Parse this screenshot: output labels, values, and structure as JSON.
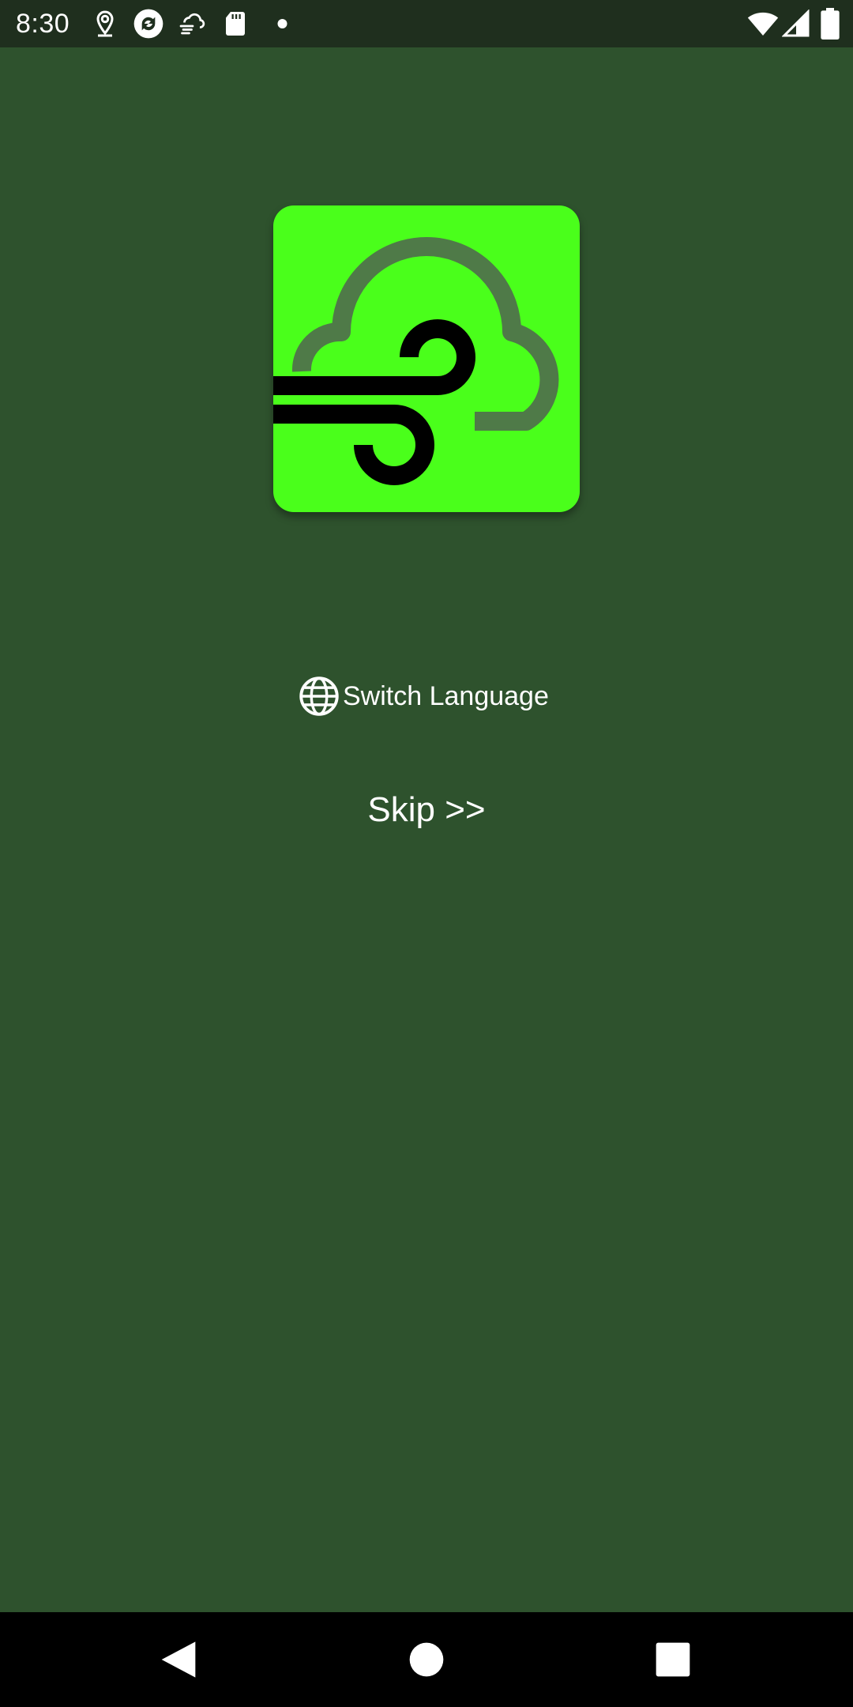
{
  "status_bar": {
    "time": "8:30",
    "icons_left": [
      "location-icon",
      "sync-app-icon",
      "weather-wind-icon",
      "sd-card-icon",
      "notification-dot-icon"
    ],
    "icons_right": [
      "wifi-icon",
      "cell-signal-icon",
      "battery-icon"
    ]
  },
  "colors": {
    "background": "#2e522d",
    "status_bar": "#1f2f1e",
    "logo_background": "#4aff1b",
    "logo_cloud": "#4f7a48",
    "logo_wind": "#000000",
    "text": "#ffffff",
    "nav_bar": "#000000"
  },
  "main": {
    "logo_icon": "cloud-wind-logo-icon",
    "switch_language": {
      "icon": "globe-icon",
      "label": "Switch Language"
    },
    "skip_label": "Skip >>"
  },
  "nav_bar": {
    "buttons": [
      "back-icon",
      "home-icon",
      "recents-icon"
    ]
  }
}
